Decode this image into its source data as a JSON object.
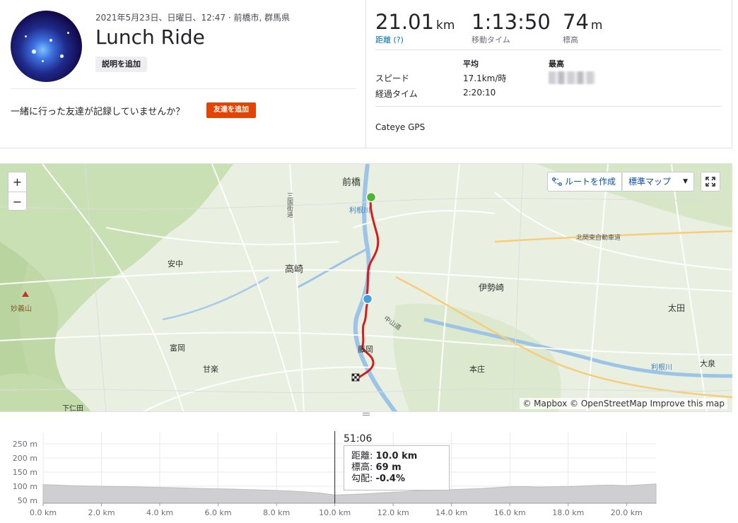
{
  "activity": {
    "meta": "2021年5月23日、日曜日、12:47 · 前橋市, 群馬県",
    "title": "Lunch Ride",
    "add_description": "説明を追加",
    "friends_question": "一緒に行った友達が記録していませんか？",
    "add_friend": "友達を追加"
  },
  "stats": {
    "distance": {
      "value": "21.01",
      "unit": "km",
      "label": "距離 (?)"
    },
    "moving_time": {
      "value": "1:13:50",
      "label": "移動タイム"
    },
    "elevation": {
      "value": "74",
      "unit": "m",
      "label": "標高"
    },
    "table": {
      "col_avg": "平均",
      "col_max": "最高",
      "rows": [
        {
          "label": "スピード",
          "avg": "17.1km/時"
        },
        {
          "label": "経過タイム",
          "avg": "2:20:10"
        }
      ]
    },
    "device": "Cateye GPS"
  },
  "map": {
    "controls": {
      "zoom_in": "+",
      "zoom_out": "−",
      "create_route": "ルートを作成",
      "map_type": "標準マップ"
    },
    "attribution": "© Mapbox © OpenStreetMap Improve this map",
    "place_labels": [
      {
        "key": "maebashi",
        "text": "前橋"
      },
      {
        "key": "tonegawa1",
        "text": "利根川"
      },
      {
        "key": "sangoku",
        "text": "三国街道"
      },
      {
        "key": "annaka",
        "text": "安中"
      },
      {
        "key": "takasaki",
        "text": "高崎"
      },
      {
        "key": "myogi",
        "text": "妙義山"
      },
      {
        "key": "isesaki",
        "text": "伊勢崎"
      },
      {
        "key": "ota",
        "text": "太田"
      },
      {
        "key": "kitakanto",
        "text": "北関東自動車道"
      },
      {
        "key": "nakasendo",
        "text": "中山道"
      },
      {
        "key": "tomioka",
        "text": "富岡"
      },
      {
        "key": "kanra",
        "text": "甘楽"
      },
      {
        "key": "fujioka",
        "text": "藤岡"
      },
      {
        "key": "honjo",
        "text": "本庄"
      },
      {
        "key": "tonegawa2",
        "text": "利根川"
      },
      {
        "key": "oizumi",
        "text": "大泉"
      },
      {
        "key": "shimonita",
        "text": "下仁田"
      }
    ],
    "colors": {
      "route": "#d11d1d",
      "start": "#4fb52e",
      "marker": "#4a9fd6",
      "land": "#e9f0e1",
      "forest": "#c9dfb4",
      "water": "#9cc4e6",
      "road": "#ffffff",
      "highway": "#f6cd7a"
    }
  },
  "elevation_chart": {
    "tooltip": {
      "time": "51:06",
      "distance_label": "距離:",
      "distance_value": "10.0 km",
      "elevation_label": "標高:",
      "elevation_value": "69 m",
      "grade_label": "勾配:",
      "grade_value": "-0.4%"
    },
    "chart_data": {
      "type": "area",
      "x": [
        0,
        0.5,
        1,
        1.5,
        2,
        2.5,
        3,
        3.5,
        4,
        4.5,
        5,
        5.5,
        6,
        6.5,
        7,
        7.5,
        8,
        8.5,
        9,
        9.5,
        10,
        10.5,
        11,
        11.5,
        12,
        12.5,
        13,
        13.5,
        14,
        14.5,
        15,
        15.5,
        16,
        16.5,
        17,
        17.5,
        18,
        18.5,
        19,
        19.5,
        20,
        20.5,
        21.01
      ],
      "y": [
        106,
        104,
        102,
        101,
        100,
        99,
        98,
        97,
        96,
        95,
        93,
        92,
        91,
        90,
        88,
        87,
        85,
        83,
        80,
        76,
        69,
        71,
        73,
        76,
        79,
        82,
        85,
        87,
        88,
        90,
        92,
        95,
        98,
        99,
        97,
        98,
        99,
        101,
        103,
        104,
        102,
        105,
        108
      ],
      "xlabel": "",
      "ylabel": "",
      "x_ticks": [
        "0.0 km",
        "2.0 km",
        "4.0 km",
        "6.0 km",
        "8.0 km",
        "10.0 km",
        "12.0 km",
        "14.0 km",
        "16.0 km",
        "18.0 km",
        "20.0 km"
      ],
      "y_ticks": [
        "250 m",
        "200 m",
        "150 m",
        "100 m",
        "50 m"
      ],
      "xlim": [
        0,
        21.01
      ],
      "ylim": [
        40,
        260
      ],
      "cursor_x": 10.0
    }
  }
}
